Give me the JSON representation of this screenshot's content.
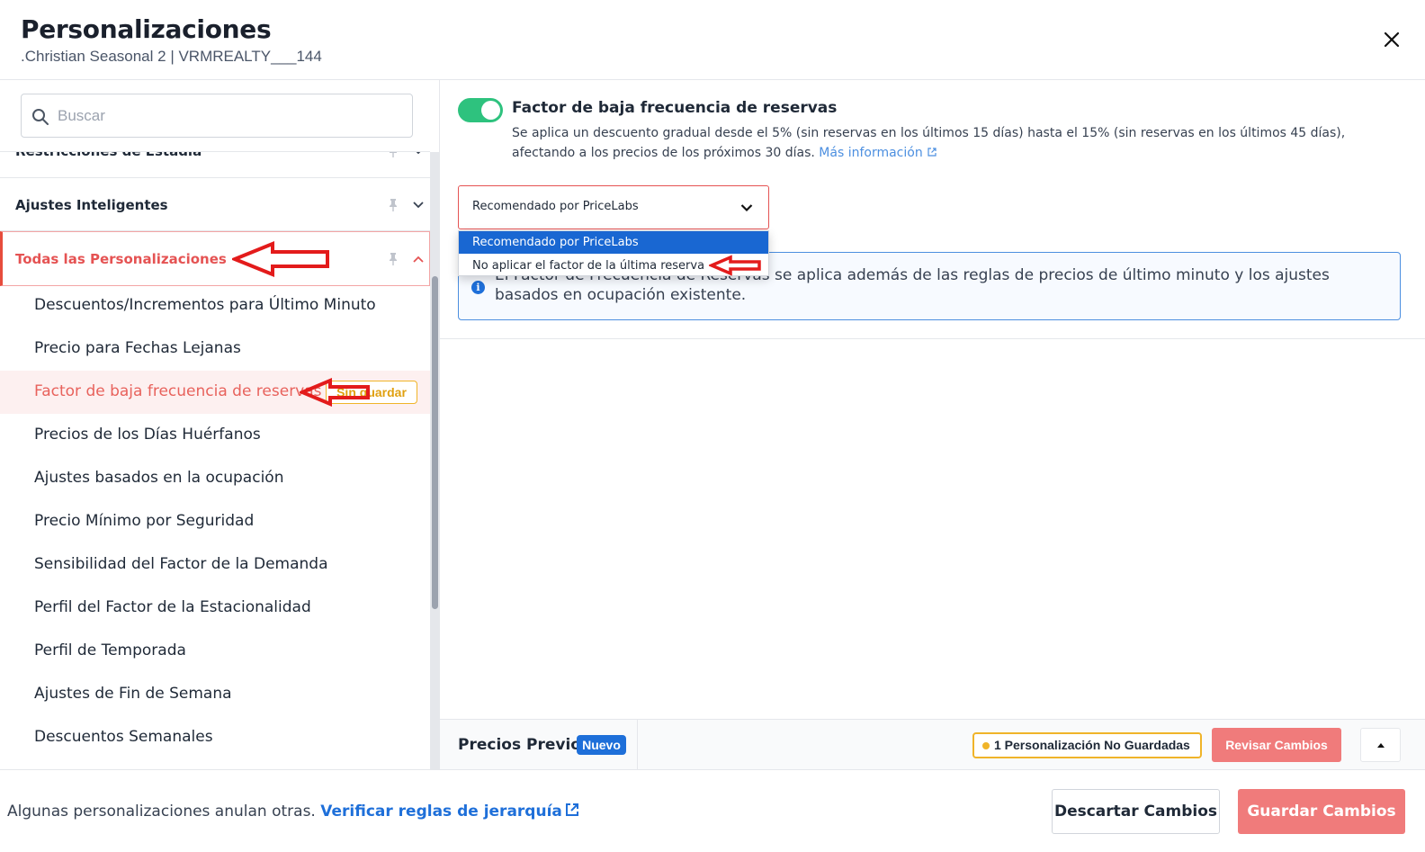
{
  "header": {
    "title": "Personalizaciones",
    "subtitle": ".Christian Seasonal 2 | VRMREALTY___144"
  },
  "sidebar": {
    "search_placeholder": "Buscar",
    "sections": [
      {
        "label": "Restricciones de Estadía",
        "expanded": false
      },
      {
        "label": "Ajustes Inteligentes",
        "expanded": false
      },
      {
        "label": "Todas las Personalizaciones",
        "expanded": true,
        "active": true
      }
    ],
    "items": [
      {
        "label": "Descuentos/Incrementos para Último Minuto"
      },
      {
        "label": "Precio para Fechas Lejanas"
      },
      {
        "label": "Factor de baja frecuencia de reservas",
        "active": true,
        "badge": "Sin guardar"
      },
      {
        "label": "Precios de los Días Huérfanos"
      },
      {
        "label": "Ajustes basados en la ocupación"
      },
      {
        "label": "Precio Mínimo por Seguridad"
      },
      {
        "label": "Sensibilidad del Factor de la Demanda"
      },
      {
        "label": "Perfil del Factor de la Estacionalidad"
      },
      {
        "label": "Perfil de Temporada"
      },
      {
        "label": "Ajustes de Fin de Semana"
      },
      {
        "label": "Descuentos Semanales"
      }
    ]
  },
  "main": {
    "toggle_on": true,
    "feature_title": "Factor de baja frecuencia de reservas",
    "feature_desc": "Se aplica un descuento gradual desde el 5% (sin reservas en los últimos 15 días) hasta el 15% (sin reservas en los últimos 45 días), afectando a los precios de los próximos 30 días.",
    "more_info": "Más información",
    "select": {
      "value": "Recomendado por PriceLabs",
      "options": [
        "Recomendado por PriceLabs",
        "No aplicar el factor de la última reserva"
      ]
    },
    "info_text": "El Factor de Frecuencia de Reservas se aplica además de las reglas de precios de último minuto y los ajustes basados en ocupación existente."
  },
  "subbar": {
    "prev_label": "Precios Previos",
    "new_badge": "Nuevo",
    "unsaved_count": "1 Personalización No Guardadas",
    "review_btn": "Revisar Cambios"
  },
  "footer": {
    "text": "Algunas personalizaciones anulan otras.",
    "link": "Verificar reglas de jerarquía",
    "discard_btn": "Descartar Cambios",
    "save_btn": "Guardar Cambios"
  },
  "colors": {
    "accent_red": "#e55353",
    "primary_blue": "#1e6fd9",
    "toggle_green": "#2ec27e",
    "warning_yellow": "#f0b429",
    "annotation_arrow": "#e31b1b"
  }
}
